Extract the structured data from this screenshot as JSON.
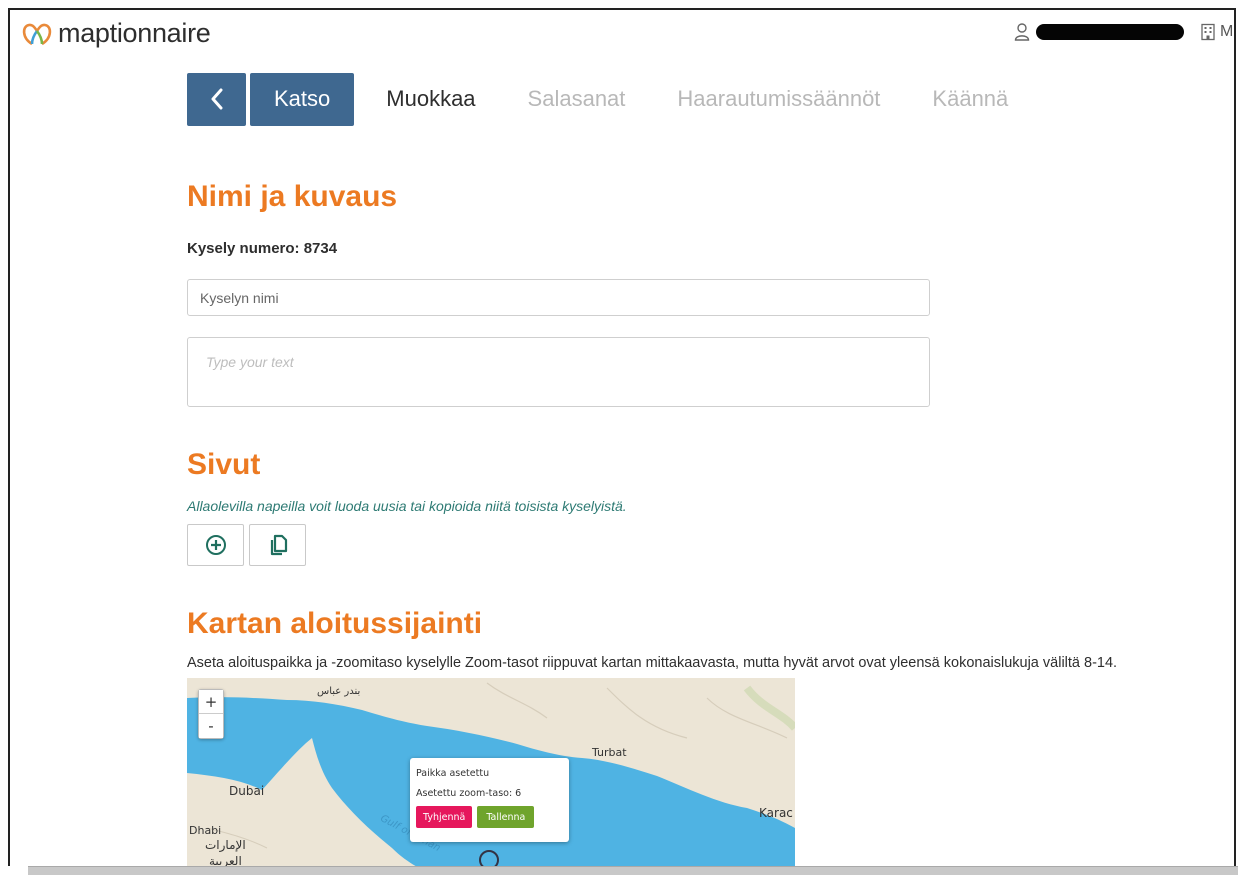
{
  "header": {
    "logo_text": "maptionnaire",
    "user_name": "",
    "org_name": "M"
  },
  "tabs": {
    "back_label": "<",
    "items": [
      {
        "label": "Katso",
        "state": "active"
      },
      {
        "label": "Muokkaa",
        "state": "enabled"
      },
      {
        "label": "Salasanat",
        "state": "disabled"
      },
      {
        "label": "Haarautumissäännöt",
        "state": "disabled"
      },
      {
        "label": "Käännä",
        "state": "disabled"
      }
    ]
  },
  "name_section": {
    "title": "Nimi ja kuvaus",
    "survey_number": "Kysely numero: 8734",
    "name_placeholder": "Kyselyn nimi",
    "description_placeholder": "Type your text"
  },
  "pages_section": {
    "title": "Sivut",
    "hint": "Allaolevilla napeilla voit luoda uusia tai kopioida niitä toisista kyselyistä.",
    "add_icon": "plus-circle-icon",
    "copy_icon": "copy-icon"
  },
  "map_section": {
    "title": "Kartan aloitussijainti",
    "hint": "Aseta aloituspaikka ja -zoomitaso kyselylle Zoom-tasot riippuvat kartan mittakaavasta, mutta hyvät arvot ovat yleensä kokonaislukuja väliltä 8-14.",
    "zoom_in": "+",
    "zoom_out": "-",
    "labels": {
      "bandar": "بندر عباس",
      "turbat": "Turbat",
      "dubai": "Dubai",
      "karachi": "Karac",
      "abu_dhabi": "Dhabi",
      "emirates": "الإمارات",
      "arabia": "العربية",
      "gulf": "Gulf of Oman"
    },
    "popup": {
      "line1": "Paikka asetettu",
      "line2": "Asetettu zoom-taso: 6",
      "clear_label": "Tyhjennä",
      "save_label": "Tallenna"
    }
  },
  "colors": {
    "accent": "#ec7a22",
    "primary": "#3f6890",
    "hint_teal": "#2d7a73",
    "clear": "#e6175c",
    "save": "#6fa42c",
    "sea": "#4fb3e3",
    "land": "#ece5d6"
  }
}
